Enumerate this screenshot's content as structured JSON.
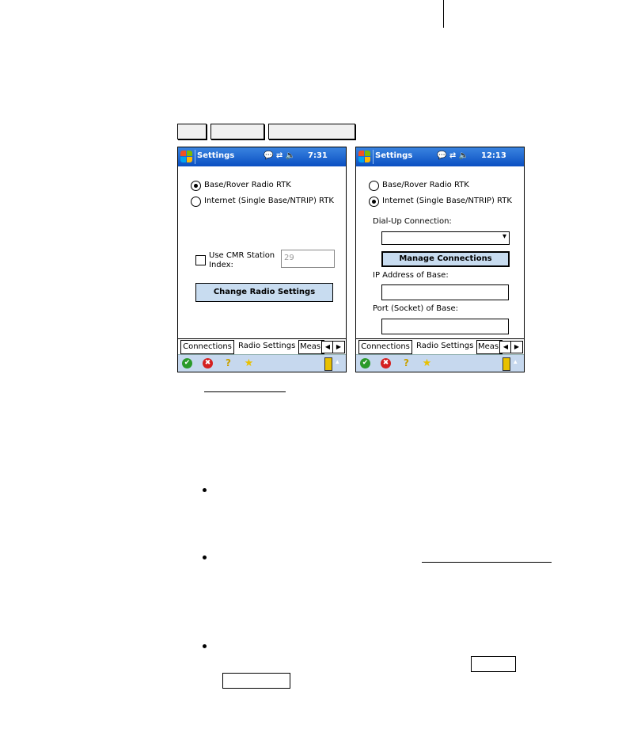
{
  "left_screen": {
    "title": "Settings",
    "status_icons": "💬 ⇄ 🔈",
    "time": "7:31",
    "radio_base_rover": "Base/Rover Radio RTK",
    "radio_internet": "Internet (Single Base/NTRIP) RTK",
    "selected": "base_rover",
    "checkbox_label_1": "Use CMR Station",
    "checkbox_label_2": "Index:",
    "station_index_value": "29",
    "change_radio_button": "Change Radio Settings",
    "tab_connections": "Connections",
    "tab_radio_settings": "Radio Settings",
    "tab_meas": "Meas"
  },
  "right_screen": {
    "title": "Settings",
    "status_icons": "💬 ⇄ 🔈",
    "time": "12:13",
    "radio_base_rover": "Base/Rover Radio RTK",
    "radio_internet": "Internet (Single Base/NTRIP) RTK",
    "selected": "internet",
    "dialup_label": "Dial-Up Connection:",
    "dialup_value": "",
    "manage_connections_button": "Manage Connections",
    "ip_label": "IP Address of Base:",
    "ip_value": "",
    "port_label": "Port (Socket) of Base:",
    "port_value": "",
    "tab_connections": "Connections",
    "tab_radio_settings": "Radio Settings",
    "tab_meas": "Meas"
  },
  "icons": {
    "arrow_left": "◀",
    "arrow_right": "▶",
    "ok": "✔",
    "cancel": "✖",
    "help": "?",
    "favorite": "★",
    "dropdown": "▾",
    "up": "▴"
  },
  "colors": {
    "titlebar": "#0a4fc2",
    "button": "#c8dcf0",
    "bottombar": "#c6d8ee",
    "ok_icon": "#2a9a2a",
    "cancel_icon": "#d42020",
    "star_icon": "#e8c000"
  }
}
